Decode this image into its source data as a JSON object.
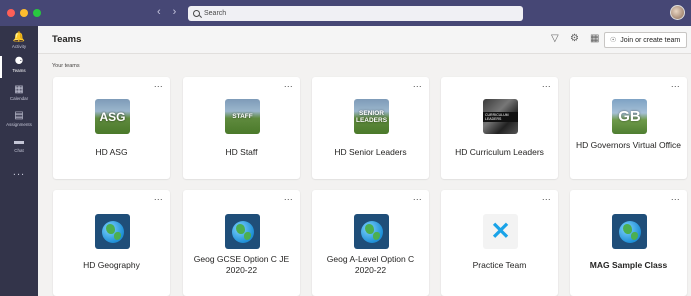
{
  "app": {
    "search_placeholder": "Search",
    "colors": {
      "titlebar": "#464775",
      "rail": "#33344a",
      "accent": "#6264a7"
    }
  },
  "rail": {
    "items": [
      {
        "label": "Activity",
        "icon": "bell-icon"
      },
      {
        "label": "Teams",
        "icon": "teams-icon"
      },
      {
        "label": "Calendar",
        "icon": "calendar-icon"
      },
      {
        "label": "Assignments",
        "icon": "assignments-icon"
      },
      {
        "label": "Chat",
        "icon": "chat-icon"
      }
    ],
    "more": "..."
  },
  "header": {
    "title": "Teams",
    "join_label": "Join or create team"
  },
  "section_label": "Your teams",
  "teams": [
    {
      "name": "HD ASG",
      "logo_text": "ASG"
    },
    {
      "name": "HD Staff",
      "logo_text": "STAFF"
    },
    {
      "name": "HD Senior Leaders",
      "logo_text": "SENIOR LEADERS"
    },
    {
      "name": "HD Curriculum Leaders",
      "logo_text": "CURRICULUM LEADERS"
    },
    {
      "name": "HD Governors Virtual Office",
      "logo_text": "GB"
    },
    {
      "name": "HD Geography",
      "logo_text": ""
    },
    {
      "name": "Geog GCSE Option C JE 2020-22",
      "logo_text": ""
    },
    {
      "name": "Geog A-Level Option C 2020-22",
      "logo_text": ""
    },
    {
      "name": "Practice Team",
      "logo_text": ""
    },
    {
      "name": "MAG Sample Class",
      "logo_text": ""
    }
  ],
  "more_label": "..."
}
